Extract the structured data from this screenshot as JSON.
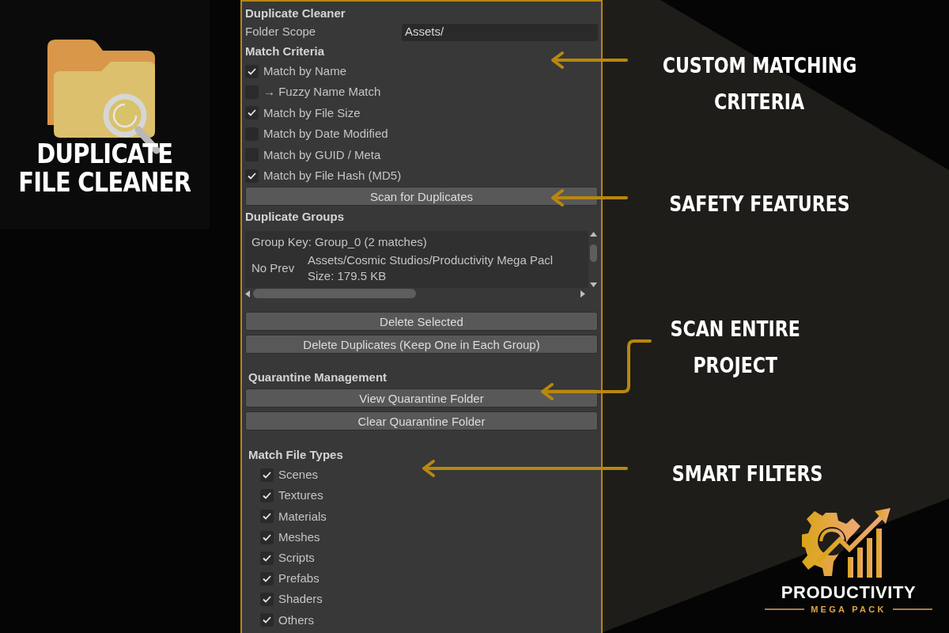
{
  "logo": {
    "title_lines": [
      "DUPLICATE",
      "FILE CLEANER"
    ]
  },
  "panel": {
    "title": "Duplicate Cleaner",
    "folder_scope": {
      "label": "Folder Scope",
      "value": "Assets/"
    },
    "criteria_heading": "Match Criteria",
    "criteria": [
      {
        "label": "Match by Name",
        "checked": true
      },
      {
        "label": "→ Fuzzy Name Match",
        "checked": false
      },
      {
        "label": "Match by File Size",
        "checked": true
      },
      {
        "label": "Match by Date Modified",
        "checked": false
      },
      {
        "label": "Match by GUID / Meta",
        "checked": false
      },
      {
        "label": "Match by File Hash (MD5)",
        "checked": true
      }
    ],
    "scan_button": "Scan for Duplicates",
    "groups_heading": "Duplicate Groups",
    "group_list": {
      "group_key": "Group Key: Group_0 (2 matches)",
      "preview": "No Prev",
      "path": "Assets/Cosmic Studios/Productivity Mega Pacl",
      "size": "Size: 179.5 KB"
    },
    "delete_buttons": [
      "Delete Selected",
      "Delete Duplicates (Keep One in Each Group)"
    ],
    "quarantine_heading": "Quarantine Management",
    "quarantine_buttons": [
      "View Quarantine Folder",
      "Clear Quarantine Folder"
    ],
    "file_types_heading": "Match File Types",
    "file_types": [
      {
        "label": "Scenes",
        "checked": true
      },
      {
        "label": "Textures",
        "checked": true
      },
      {
        "label": "Materials",
        "checked": true
      },
      {
        "label": "Meshes",
        "checked": true
      },
      {
        "label": "Scripts",
        "checked": true
      },
      {
        "label": "Prefabs",
        "checked": true
      },
      {
        "label": "Shaders",
        "checked": true
      },
      {
        "label": "Others",
        "checked": true
      }
    ]
  },
  "callouts": [
    {
      "lines": [
        "CUSTOM MATCHING",
        "CRITERIA"
      ]
    },
    {
      "lines": [
        "SAFETY FEATURES"
      ]
    },
    {
      "lines": [
        "SCAN ENTIRE",
        "PROJECT"
      ]
    },
    {
      "lines": [
        "SMART FILTERS"
      ]
    }
  ],
  "brand": {
    "name": "PRODUCTIVITY",
    "subtitle": "MEGA PACK"
  }
}
